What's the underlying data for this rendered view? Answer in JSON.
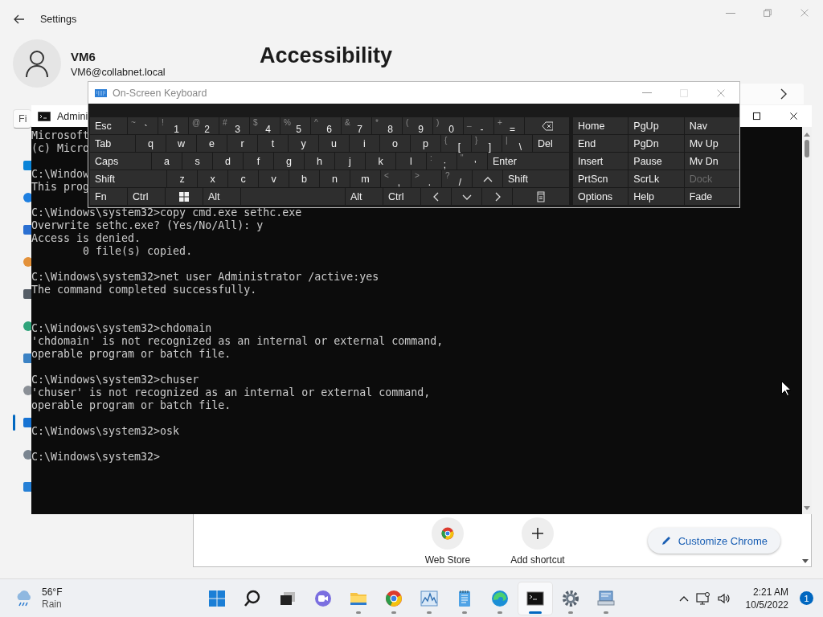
{
  "settings": {
    "title": "Settings",
    "user": {
      "name": "VM6",
      "email": "VM6@collabnet.local"
    },
    "search": {
      "placeholder": "Fi"
    },
    "page_title": "Accessibility",
    "sidebar": {
      "items": [
        {
          "selected": false
        },
        {
          "selected": false
        },
        {
          "selected": false
        },
        {
          "selected": false
        },
        {
          "selected": false
        },
        {
          "selected": false
        },
        {
          "selected": false
        },
        {
          "selected": false
        },
        {
          "selected": true
        },
        {
          "selected": false
        },
        {
          "selected": false
        }
      ]
    }
  },
  "chrome": {
    "shortcuts": [
      {
        "kind": "store",
        "label": "Web Store"
      },
      {
        "kind": "add",
        "label": "Add shortcut"
      }
    ],
    "customize_button": "Customize Chrome"
  },
  "cmd": {
    "title": "Admini",
    "lines": [
      {
        "kind": "text",
        "text": "Microsoft"
      },
      {
        "kind": "text",
        "text": "(c) Micro"
      },
      {
        "kind": "blank"
      },
      {
        "kind": "text",
        "text": "C:\\Window"
      },
      {
        "kind": "text",
        "text": "This prog"
      },
      {
        "kind": "blank"
      },
      {
        "kind": "text",
        "text": "C:\\Windows\\system32>copy cmd.exe sethc.exe"
      },
      {
        "kind": "text",
        "text": "Overwrite sethc.exe? (Yes/No/All): y"
      },
      {
        "kind": "text",
        "text": "Access is denied."
      },
      {
        "kind": "text",
        "text": "        0 file(s) copied."
      },
      {
        "kind": "blank"
      },
      {
        "kind": "text",
        "text": "C:\\Windows\\system32>net user Administrator /active:yes"
      },
      {
        "kind": "text",
        "text": "The command completed successfully."
      },
      {
        "kind": "blank"
      },
      {
        "kind": "blank"
      },
      {
        "kind": "text",
        "text": "C:\\Windows\\system32>chdomain"
      },
      {
        "kind": "text",
        "text": "'chdomain' is not recognized as an internal or external command,"
      },
      {
        "kind": "text",
        "text": "operable program or batch file."
      },
      {
        "kind": "blank"
      },
      {
        "kind": "text",
        "text": "C:\\Windows\\system32>chuser"
      },
      {
        "kind": "text",
        "text": "'chuser' is not recognized as an internal or external command,"
      },
      {
        "kind": "text",
        "text": "operable program or batch file."
      },
      {
        "kind": "blank"
      },
      {
        "kind": "text",
        "text": "C:\\Windows\\system32>osk"
      },
      {
        "kind": "blank"
      },
      {
        "kind": "text",
        "text": "C:\\Windows\\system32>"
      }
    ]
  },
  "osk": {
    "title": "On-Screen Keyboard",
    "main_rows": [
      [
        {
          "kind": "word",
          "label": "Esc"
        },
        {
          "kind": "char",
          "shift": "~",
          "label": "`"
        },
        {
          "kind": "char",
          "shift": "!",
          "label": "1"
        },
        {
          "kind": "char",
          "shift": "@",
          "label": "2"
        },
        {
          "kind": "char",
          "shift": "#",
          "label": "3"
        },
        {
          "kind": "char",
          "shift": "$",
          "label": "4"
        },
        {
          "kind": "char",
          "shift": "%",
          "label": "5"
        },
        {
          "kind": "char",
          "shift": "^",
          "label": "6"
        },
        {
          "kind": "char",
          "shift": "&",
          "label": "7"
        },
        {
          "kind": "char",
          "shift": "*",
          "label": "8"
        },
        {
          "kind": "char",
          "shift": "(",
          "label": "9"
        },
        {
          "kind": "char",
          "shift": ")",
          "label": "0"
        },
        {
          "kind": "char",
          "shift": "_",
          "label": "-"
        },
        {
          "kind": "char",
          "shift": "+",
          "label": "="
        },
        {
          "kind": "backspace"
        }
      ],
      [
        {
          "kind": "word",
          "label": "Tab"
        },
        {
          "kind": "char",
          "label": "q"
        },
        {
          "kind": "char",
          "label": "w"
        },
        {
          "kind": "char",
          "label": "e"
        },
        {
          "kind": "char",
          "label": "r"
        },
        {
          "kind": "char",
          "label": "t"
        },
        {
          "kind": "char",
          "label": "y"
        },
        {
          "kind": "char",
          "label": "u"
        },
        {
          "kind": "char",
          "label": "i"
        },
        {
          "kind": "char",
          "label": "o"
        },
        {
          "kind": "char",
          "label": "p"
        },
        {
          "kind": "char",
          "shift": "{",
          "label": "["
        },
        {
          "kind": "char",
          "shift": "}",
          "label": "]"
        },
        {
          "kind": "char",
          "shift": "|",
          "label": "\\"
        },
        {
          "kind": "word",
          "label": "Del"
        }
      ],
      [
        {
          "kind": "word",
          "label": "Caps"
        },
        {
          "kind": "char",
          "label": "a"
        },
        {
          "kind": "char",
          "label": "s"
        },
        {
          "kind": "char",
          "label": "d"
        },
        {
          "kind": "char",
          "label": "f"
        },
        {
          "kind": "char",
          "label": "g"
        },
        {
          "kind": "char",
          "label": "h"
        },
        {
          "kind": "char",
          "label": "j"
        },
        {
          "kind": "char",
          "label": "k"
        },
        {
          "kind": "char",
          "label": "l"
        },
        {
          "kind": "char",
          "shift": ":",
          "label": ";"
        },
        {
          "kind": "char",
          "shift": "\"",
          "label": "'"
        },
        {
          "kind": "word",
          "label": "Enter"
        }
      ],
      [
        {
          "kind": "word",
          "label": "Shift"
        },
        {
          "kind": "char",
          "label": "z"
        },
        {
          "kind": "char",
          "label": "x"
        },
        {
          "kind": "char",
          "label": "c"
        },
        {
          "kind": "char",
          "label": "v"
        },
        {
          "kind": "char",
          "label": "b"
        },
        {
          "kind": "char",
          "label": "n"
        },
        {
          "kind": "char",
          "label": "m"
        },
        {
          "kind": "char",
          "shift": "<",
          "label": ","
        },
        {
          "kind": "char",
          "shift": ">",
          "label": "."
        },
        {
          "kind": "char",
          "shift": "?",
          "label": "/"
        },
        {
          "kind": "up"
        },
        {
          "kind": "word",
          "label": "Shift"
        }
      ],
      [
        {
          "kind": "word",
          "label": "Fn"
        },
        {
          "kind": "word",
          "label": "Ctrl"
        },
        {
          "kind": "windows"
        },
        {
          "kind": "word",
          "label": "Alt"
        },
        {
          "kind": "space"
        },
        {
          "kind": "word",
          "label": "Alt"
        },
        {
          "kind": "word",
          "label": "Ctrl"
        },
        {
          "kind": "left"
        },
        {
          "kind": "down"
        },
        {
          "kind": "right"
        },
        {
          "kind": "menu"
        }
      ]
    ],
    "nav_rows": [
      [
        {
          "label": "Home",
          "disabled": false
        },
        {
          "label": "PgUp",
          "disabled": false
        },
        {
          "label": "Nav",
          "disabled": false
        }
      ],
      [
        {
          "label": "End",
          "disabled": false
        },
        {
          "label": "PgDn",
          "disabled": false
        },
        {
          "label": "Mv Up",
          "disabled": false
        }
      ],
      [
        {
          "label": "Insert",
          "disabled": false
        },
        {
          "label": "Pause",
          "disabled": false
        },
        {
          "label": "Mv Dn",
          "disabled": false
        }
      ],
      [
        {
          "label": "PrtScn",
          "disabled": false
        },
        {
          "label": "ScrLk",
          "disabled": false
        },
        {
          "label": "Dock",
          "disabled": true
        }
      ],
      [
        {
          "label": "Options",
          "disabled": false
        },
        {
          "label": "Help",
          "disabled": false
        },
        {
          "label": "Fade",
          "disabled": false
        }
      ]
    ]
  },
  "taskbar": {
    "weather": {
      "temperature": "56°F",
      "condition": "Rain"
    },
    "apps": [
      {
        "kind": "start",
        "running": false,
        "selected": false
      },
      {
        "kind": "search",
        "running": false,
        "selected": false
      },
      {
        "kind": "taskview",
        "running": false,
        "selected": false
      },
      {
        "kind": "chat",
        "running": false,
        "selected": false
      },
      {
        "kind": "folder",
        "running": true,
        "selected": false
      },
      {
        "kind": "browser",
        "running": true,
        "selected": false
      },
      {
        "kind": "monitor",
        "running": true,
        "selected": false
      },
      {
        "kind": "notepad",
        "running": true,
        "selected": false
      },
      {
        "kind": "edge",
        "running": true,
        "selected": false
      },
      {
        "kind": "terminal",
        "running": true,
        "selected": true
      },
      {
        "kind": "settings",
        "running": true,
        "selected": false
      },
      {
        "kind": "remote",
        "running": true,
        "selected": false
      }
    ],
    "tray": {
      "time": "2:21 AM",
      "date": "10/5/2022",
      "notifications": "1"
    }
  }
}
